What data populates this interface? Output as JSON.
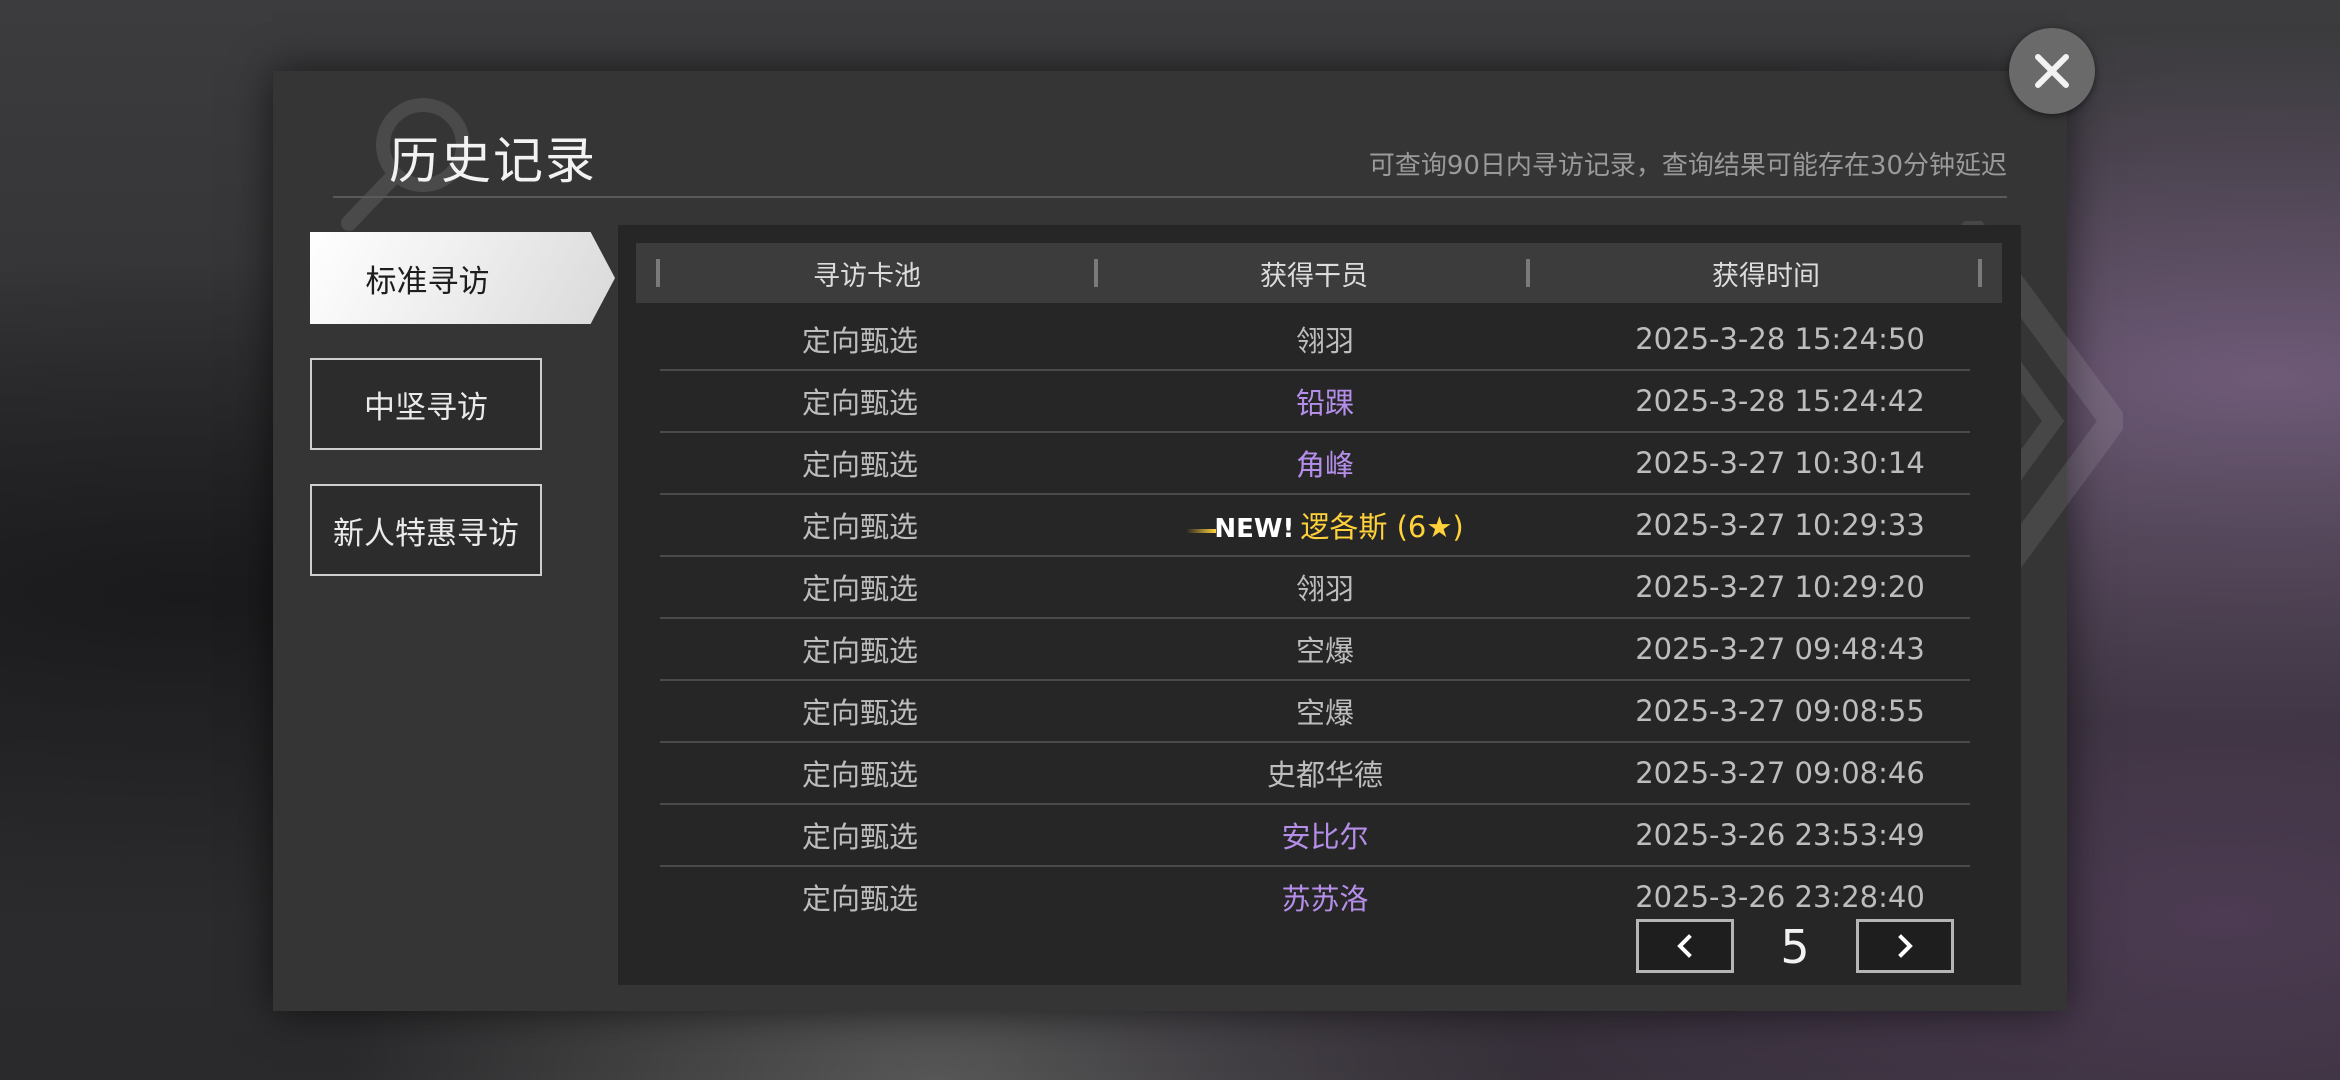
{
  "dialog": {
    "title": "历史记录",
    "subtitle": "可查询90日内寻访记录，查询结果可能存在30分钟延迟",
    "tabs": [
      {
        "label": "标准寻访",
        "active": true
      },
      {
        "label": "中坚寻访",
        "active": false
      },
      {
        "label": "新人特惠寻访",
        "active": false
      }
    ],
    "columns": [
      "寻访卡池",
      "获得干员",
      "获得时间"
    ],
    "rows": [
      {
        "pool": "定向甄选",
        "operator": "翎羽",
        "time": "2025-3-28 15:24:50",
        "rarity": "normal"
      },
      {
        "pool": "定向甄选",
        "operator": "铅踝",
        "time": "2025-3-28 15:24:42",
        "rarity": "purple"
      },
      {
        "pool": "定向甄选",
        "operator": "角峰",
        "time": "2025-3-27 10:30:14",
        "rarity": "purple"
      },
      {
        "pool": "定向甄选",
        "new_tag": "NEW!",
        "operator": "逻各斯 (6★)",
        "time": "2025-3-27 10:29:33",
        "rarity": "gold"
      },
      {
        "pool": "定向甄选",
        "operator": "翎羽",
        "time": "2025-3-27 10:29:20",
        "rarity": "normal"
      },
      {
        "pool": "定向甄选",
        "operator": "空爆",
        "time": "2025-3-27 09:48:43",
        "rarity": "normal"
      },
      {
        "pool": "定向甄选",
        "operator": "空爆",
        "time": "2025-3-27 09:08:55",
        "rarity": "normal"
      },
      {
        "pool": "定向甄选",
        "operator": "史都华德",
        "time": "2025-3-27 09:08:46",
        "rarity": "normal"
      },
      {
        "pool": "定向甄选",
        "operator": "安比尔",
        "time": "2025-3-26 23:53:49",
        "rarity": "purple"
      },
      {
        "pool": "定向甄选",
        "operator": "苏苏洛",
        "time": "2025-3-26 23:28:40",
        "rarity": "purple"
      }
    ],
    "pagination": {
      "page": "5"
    }
  },
  "icons": {
    "close": "close-icon",
    "prev": "chevron-left-icon",
    "next": "chevron-right-icon",
    "decor": "magnifier-icon"
  },
  "colors": {
    "purple": "#b48ee8",
    "gold": "#ffd13a",
    "panel": "#262626",
    "dialog": "#353535"
  }
}
